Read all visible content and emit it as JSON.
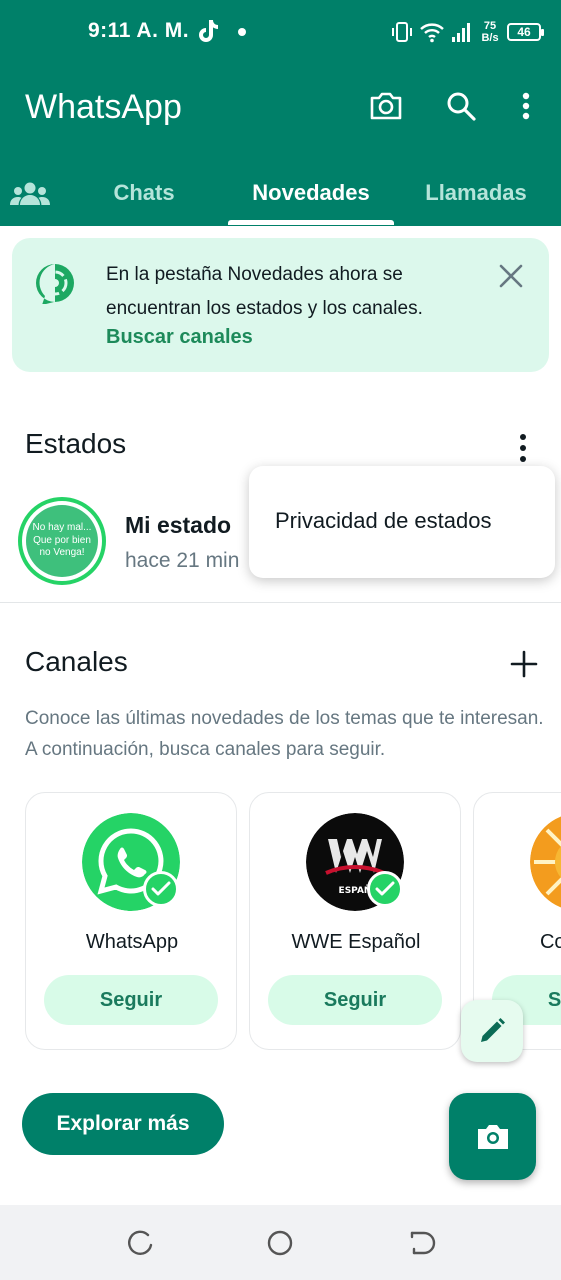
{
  "status_bar": {
    "time": "9:11 A. M.",
    "net_speed_value": "75",
    "net_speed_unit": "B/s",
    "battery": "46"
  },
  "header": {
    "title": "WhatsApp",
    "icons": [
      "camera-icon",
      "search-icon",
      "more-vert-icon"
    ],
    "tabs": [
      {
        "label": "",
        "icon": "communities-icon",
        "active": false
      },
      {
        "label": "Chats",
        "active": false
      },
      {
        "label": "Novedades",
        "active": true
      },
      {
        "label": "Llamadas",
        "active": false
      }
    ]
  },
  "banner": {
    "text": "En la pestaña Novedades ahora se encuentran los estados y los canales.",
    "link": "Buscar canales"
  },
  "estados": {
    "title": "Estados",
    "my_status": {
      "avatar_text": "No hay mal... Que por bien no Venga!",
      "name": "Mi estado",
      "time": "hace 21 min"
    }
  },
  "popup_menu": {
    "items": [
      "Privacidad de estados"
    ]
  },
  "canales": {
    "title": "Canales",
    "description": "Conoce las últimas novedades de los temas que te interesan. A continuación, busca canales para seguir.",
    "cards": [
      {
        "name": "WhatsApp",
        "button": "Seguir"
      },
      {
        "name": "WWE Español",
        "button": "Seguir",
        "avatar_text": "ESPAÑ"
      },
      {
        "name": "Comedia",
        "button": "Seguir"
      }
    ],
    "explore_button": "Explorar más"
  },
  "colors": {
    "primary": "#008069",
    "accent": "#25d366",
    "banner_bg": "#dcf8ec",
    "link_green": "#1d8a5a"
  }
}
